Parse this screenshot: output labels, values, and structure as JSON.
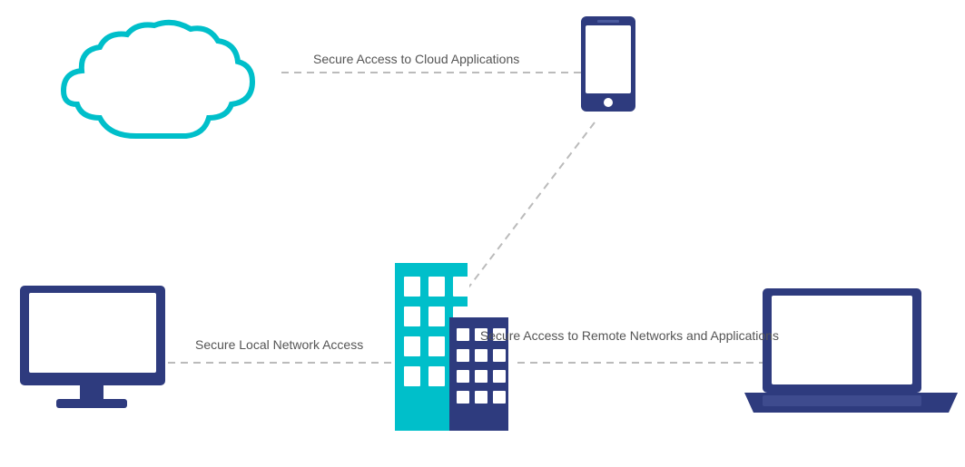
{
  "labels": {
    "cloud_access": "Secure Access to\nCloud Applications",
    "local_access": "Secure Local\nNetwork Access",
    "remote_access": "Secure Access to\nRemote Networks\nand Applications"
  },
  "colors": {
    "teal": "#00BFCA",
    "navy": "#2E3B7E",
    "dashed_line": "#BBBBBB",
    "white": "#FFFFFF"
  }
}
